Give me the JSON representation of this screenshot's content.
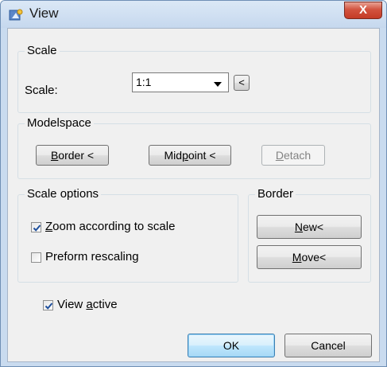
{
  "window": {
    "title": "View",
    "close_glyph": "X"
  },
  "scale_group": {
    "title": "Scale",
    "scale_label": "Scale:",
    "scale_value": "1:1",
    "pick_button": "<"
  },
  "modelspace_group": {
    "title": "Modelspace",
    "border_button": {
      "pre": "",
      "key": "B",
      "post": "order <"
    },
    "midpoint_button": {
      "pre": "Mid",
      "key": "p",
      "post": "oint <"
    },
    "detach_button": {
      "pre": "",
      "key": "D",
      "post": "etach"
    }
  },
  "scale_options_group": {
    "title": "Scale options",
    "zoom_checkbox": {
      "checked": true,
      "pre": "",
      "key": "Z",
      "post": "oom according to scale"
    },
    "rescale_checkbox": {
      "checked": false,
      "label": "Preform rescaling"
    }
  },
  "border_group": {
    "title": "Border",
    "new_button": {
      "pre": "",
      "key": "N",
      "post": "ew<"
    },
    "move_button": {
      "pre": "",
      "key": "M",
      "post": "ove<"
    }
  },
  "view_active_checkbox": {
    "checked": true,
    "pre": "View ",
    "key": "a",
    "post": "ctive"
  },
  "footer": {
    "ok_label": "OK",
    "cancel_label": "Cancel"
  },
  "colors": {
    "accent": "#3c7fb1",
    "titlebar": "#c9dbef",
    "close": "#c43b26"
  }
}
